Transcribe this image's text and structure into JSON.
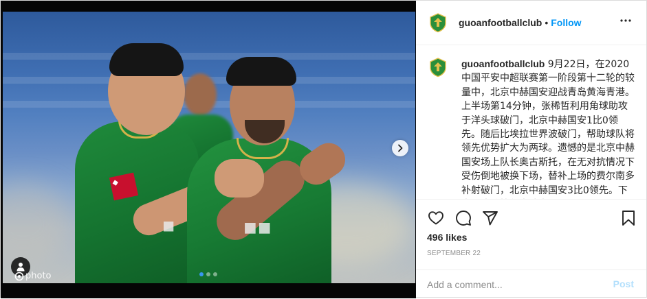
{
  "post": {
    "media": {
      "alt_icon": "person-icon",
      "watermark_text": "photo",
      "carousel": {
        "total": 3,
        "active": 1
      }
    },
    "header": {
      "username": "guoanfootballclub",
      "separator": "•",
      "follow_label": "Follow",
      "more_icon": "more-horizontal-icon"
    },
    "caption": {
      "username": "guoanfootballclub",
      "text": " 9月22日，在2020中国平安中超联赛第一阶段第十二轮的较量中，北京中赫国安迎战青岛黄海青港。上半场第14分钟，张稀哲利用角球助攻于洋头球破门，北京中赫国安1比0领先。随后比埃拉世界波破门，帮助球队将领先优势扩大为两球。遗憾的是北京中赫国安场上队长奥古斯托，在无对抗情况下受伤倒地被换下场，替补上场的费尔南多补射破门，北京中赫国安3比0领先。下半场比埃拉任意球直"
    },
    "actions": {
      "like_icon": "heart-icon",
      "comment_icon": "comment-icon",
      "share_icon": "share-icon",
      "save_icon": "bookmark-icon"
    },
    "likes_text": "496 likes",
    "date_text": "SEPTEMBER 22",
    "comment": {
      "placeholder": "Add a comment...",
      "post_label": "Post"
    },
    "colors": {
      "accent": "#0095f6",
      "post_disabled": "#b2dffc",
      "jersey_green": "#157430",
      "club_logo_green": "#2a8f3a",
      "club_logo_gold": "#e3c04b"
    }
  }
}
